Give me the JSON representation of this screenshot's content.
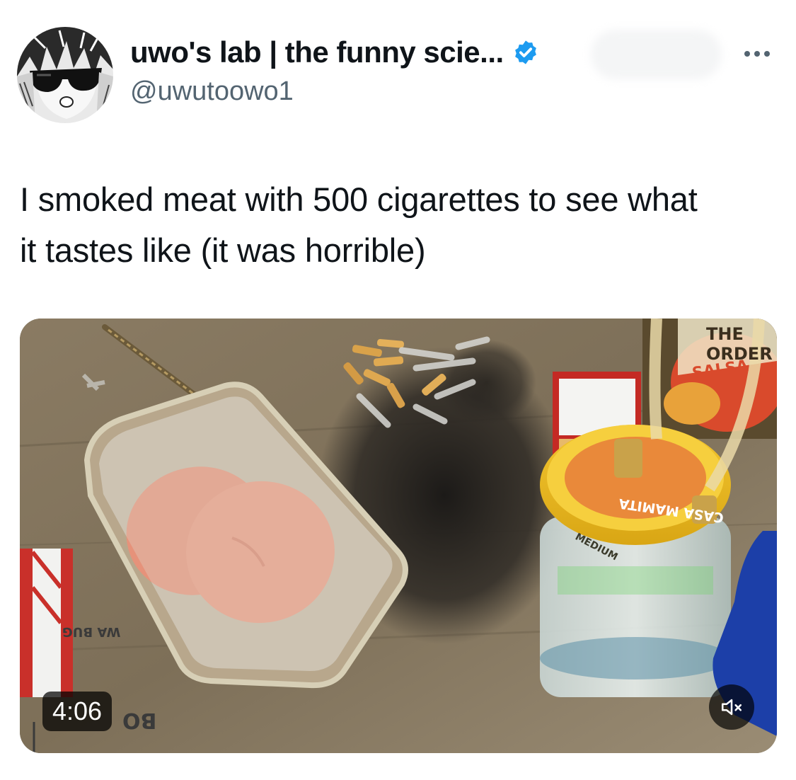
{
  "author": {
    "display_name": "uwo's lab | the funny scie...",
    "handle": "@uwutoowo1",
    "verified": true,
    "avatar_icon": "sunglasses-anime-avatar"
  },
  "tweet": {
    "text": "I smoked meat with 500 cigarettes to see what\nit tastes like (it was horrible)"
  },
  "media": {
    "type": "video",
    "duration": "4:06",
    "mute_icon": "speaker-muted-icon",
    "visible_labels": {
      "jar_lid": "CASA MAMITA",
      "jar_band": "MEDIUM",
      "bottle_label": "THE ORDER",
      "bottle_sub": "SALSA",
      "table_marking": "WA BUG",
      "table_marking_2": "BO"
    }
  },
  "colors": {
    "text_primary": "#0f1419",
    "text_secondary": "#536471",
    "verified_blue": "#1d9bf0"
  }
}
